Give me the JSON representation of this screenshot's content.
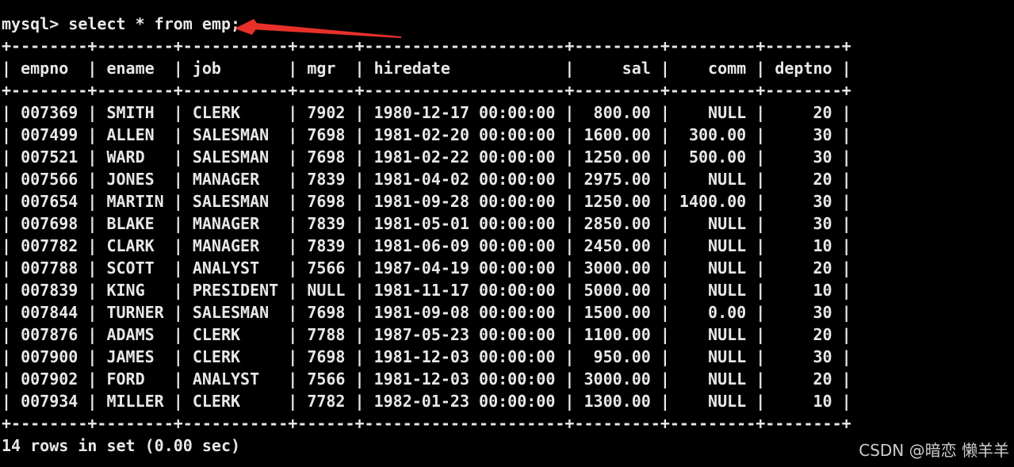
{
  "terminal": {
    "prompt": "mysql> ",
    "command": "select * from emp;",
    "columns": [
      "empno",
      "ename",
      "job",
      "mgr",
      "hiredate",
      "sal",
      "comm",
      "deptno"
    ],
    "rows": [
      [
        "007369",
        "SMITH",
        "CLERK",
        "7902",
        "1980-12-17 00:00:00",
        "800.00",
        "NULL",
        "20"
      ],
      [
        "007499",
        "ALLEN",
        "SALESMAN",
        "7698",
        "1981-02-20 00:00:00",
        "1600.00",
        "300.00",
        "30"
      ],
      [
        "007521",
        "WARD",
        "SALESMAN",
        "7698",
        "1981-02-22 00:00:00",
        "1250.00",
        "500.00",
        "30"
      ],
      [
        "007566",
        "JONES",
        "MANAGER",
        "7839",
        "1981-04-02 00:00:00",
        "2975.00",
        "NULL",
        "20"
      ],
      [
        "007654",
        "MARTIN",
        "SALESMAN",
        "7698",
        "1981-09-28 00:00:00",
        "1250.00",
        "1400.00",
        "30"
      ],
      [
        "007698",
        "BLAKE",
        "MANAGER",
        "7839",
        "1981-05-01 00:00:00",
        "2850.00",
        "NULL",
        "30"
      ],
      [
        "007782",
        "CLARK",
        "MANAGER",
        "7839",
        "1981-06-09 00:00:00",
        "2450.00",
        "NULL",
        "10"
      ],
      [
        "007788",
        "SCOTT",
        "ANALYST",
        "7566",
        "1987-04-19 00:00:00",
        "3000.00",
        "NULL",
        "20"
      ],
      [
        "007839",
        "KING",
        "PRESIDENT",
        "NULL",
        "1981-11-17 00:00:00",
        "5000.00",
        "NULL",
        "10"
      ],
      [
        "007844",
        "TURNER",
        "SALESMAN",
        "7698",
        "1981-09-08 00:00:00",
        "1500.00",
        "0.00",
        "30"
      ],
      [
        "007876",
        "ADAMS",
        "CLERK",
        "7788",
        "1987-05-23 00:00:00",
        "1100.00",
        "NULL",
        "20"
      ],
      [
        "007900",
        "JAMES",
        "CLERK",
        "7698",
        "1981-12-03 00:00:00",
        "950.00",
        "NULL",
        "30"
      ],
      [
        "007902",
        "FORD",
        "ANALYST",
        "7566",
        "1981-12-03 00:00:00",
        "3000.00",
        "NULL",
        "20"
      ],
      [
        "007934",
        "MILLER",
        "CLERK",
        "7782",
        "1982-01-23 00:00:00",
        "1300.00",
        "NULL",
        "10"
      ]
    ],
    "summary": "14 rows in set (0.00 sec)"
  },
  "watermark": "CSDN @暗恋 懒羊羊",
  "colors": {
    "background": "#000000",
    "text": "#e8e8e8",
    "arrow": "#e8302a"
  }
}
